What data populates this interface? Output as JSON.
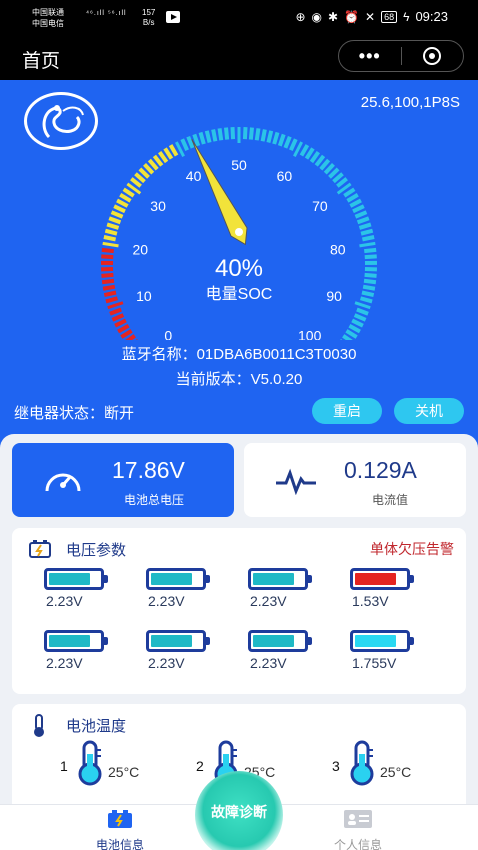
{
  "status_bar": {
    "carrier1": "中国联通",
    "carrier2": "中国电信",
    "net1": "⁴⁶.ıll ⁵⁶.ıll",
    "speed": "157",
    "speed_unit": "B/s",
    "battery": "68",
    "time": "09:23"
  },
  "title_bar": {
    "title": "首页",
    "more": "•••"
  },
  "hero": {
    "spec": "25.6,100,1P8S",
    "gauge": {
      "percent": 40,
      "percent_text": "40%",
      "label": "电量SOC",
      "ticks": [
        "0",
        "10",
        "20",
        "30",
        "40",
        "50",
        "60",
        "70",
        "80",
        "90",
        "100"
      ]
    },
    "bt_label": "蓝牙名称：",
    "bt_name": "01DBA6B0011C3T0030",
    "version_label": "当前版本：",
    "version": "V5.0.20",
    "relay_label": "继电器状态：",
    "relay_state": "断开",
    "btn_restart": "重启",
    "btn_shutdown": "关机"
  },
  "summary": {
    "voltage": "17.86V",
    "voltage_label": "电池总电压",
    "current": "0.129A",
    "current_label": "电流值"
  },
  "cells": {
    "title": "电压参数",
    "alarm": "单体欠压告警",
    "items": [
      {
        "v": "2.23V",
        "level": 0.82,
        "color": "#1fb9c6"
      },
      {
        "v": "2.23V",
        "level": 0.82,
        "color": "#1fb9c6"
      },
      {
        "v": "2.23V",
        "level": 0.82,
        "color": "#1fb9c6"
      },
      {
        "v": "1.53V",
        "level": 0.82,
        "color": "#e52420"
      },
      {
        "v": "2.23V",
        "level": 0.82,
        "color": "#1fb9c6"
      },
      {
        "v": "2.23V",
        "level": 0.82,
        "color": "#1fb9c6"
      },
      {
        "v": "2.23V",
        "level": 0.82,
        "color": "#1fb9c6"
      },
      {
        "v": "1.755V",
        "level": 0.82,
        "color": "#2ad8f2"
      }
    ]
  },
  "temps": {
    "title": "电池温度",
    "items": [
      {
        "n": "1",
        "t": "25°C"
      },
      {
        "n": "2",
        "t": "25°C"
      },
      {
        "n": "3",
        "t": "25°C"
      }
    ]
  },
  "nav": {
    "battery_info": "电池信息",
    "diagnose": "故障诊断",
    "personal": "个人信息"
  }
}
